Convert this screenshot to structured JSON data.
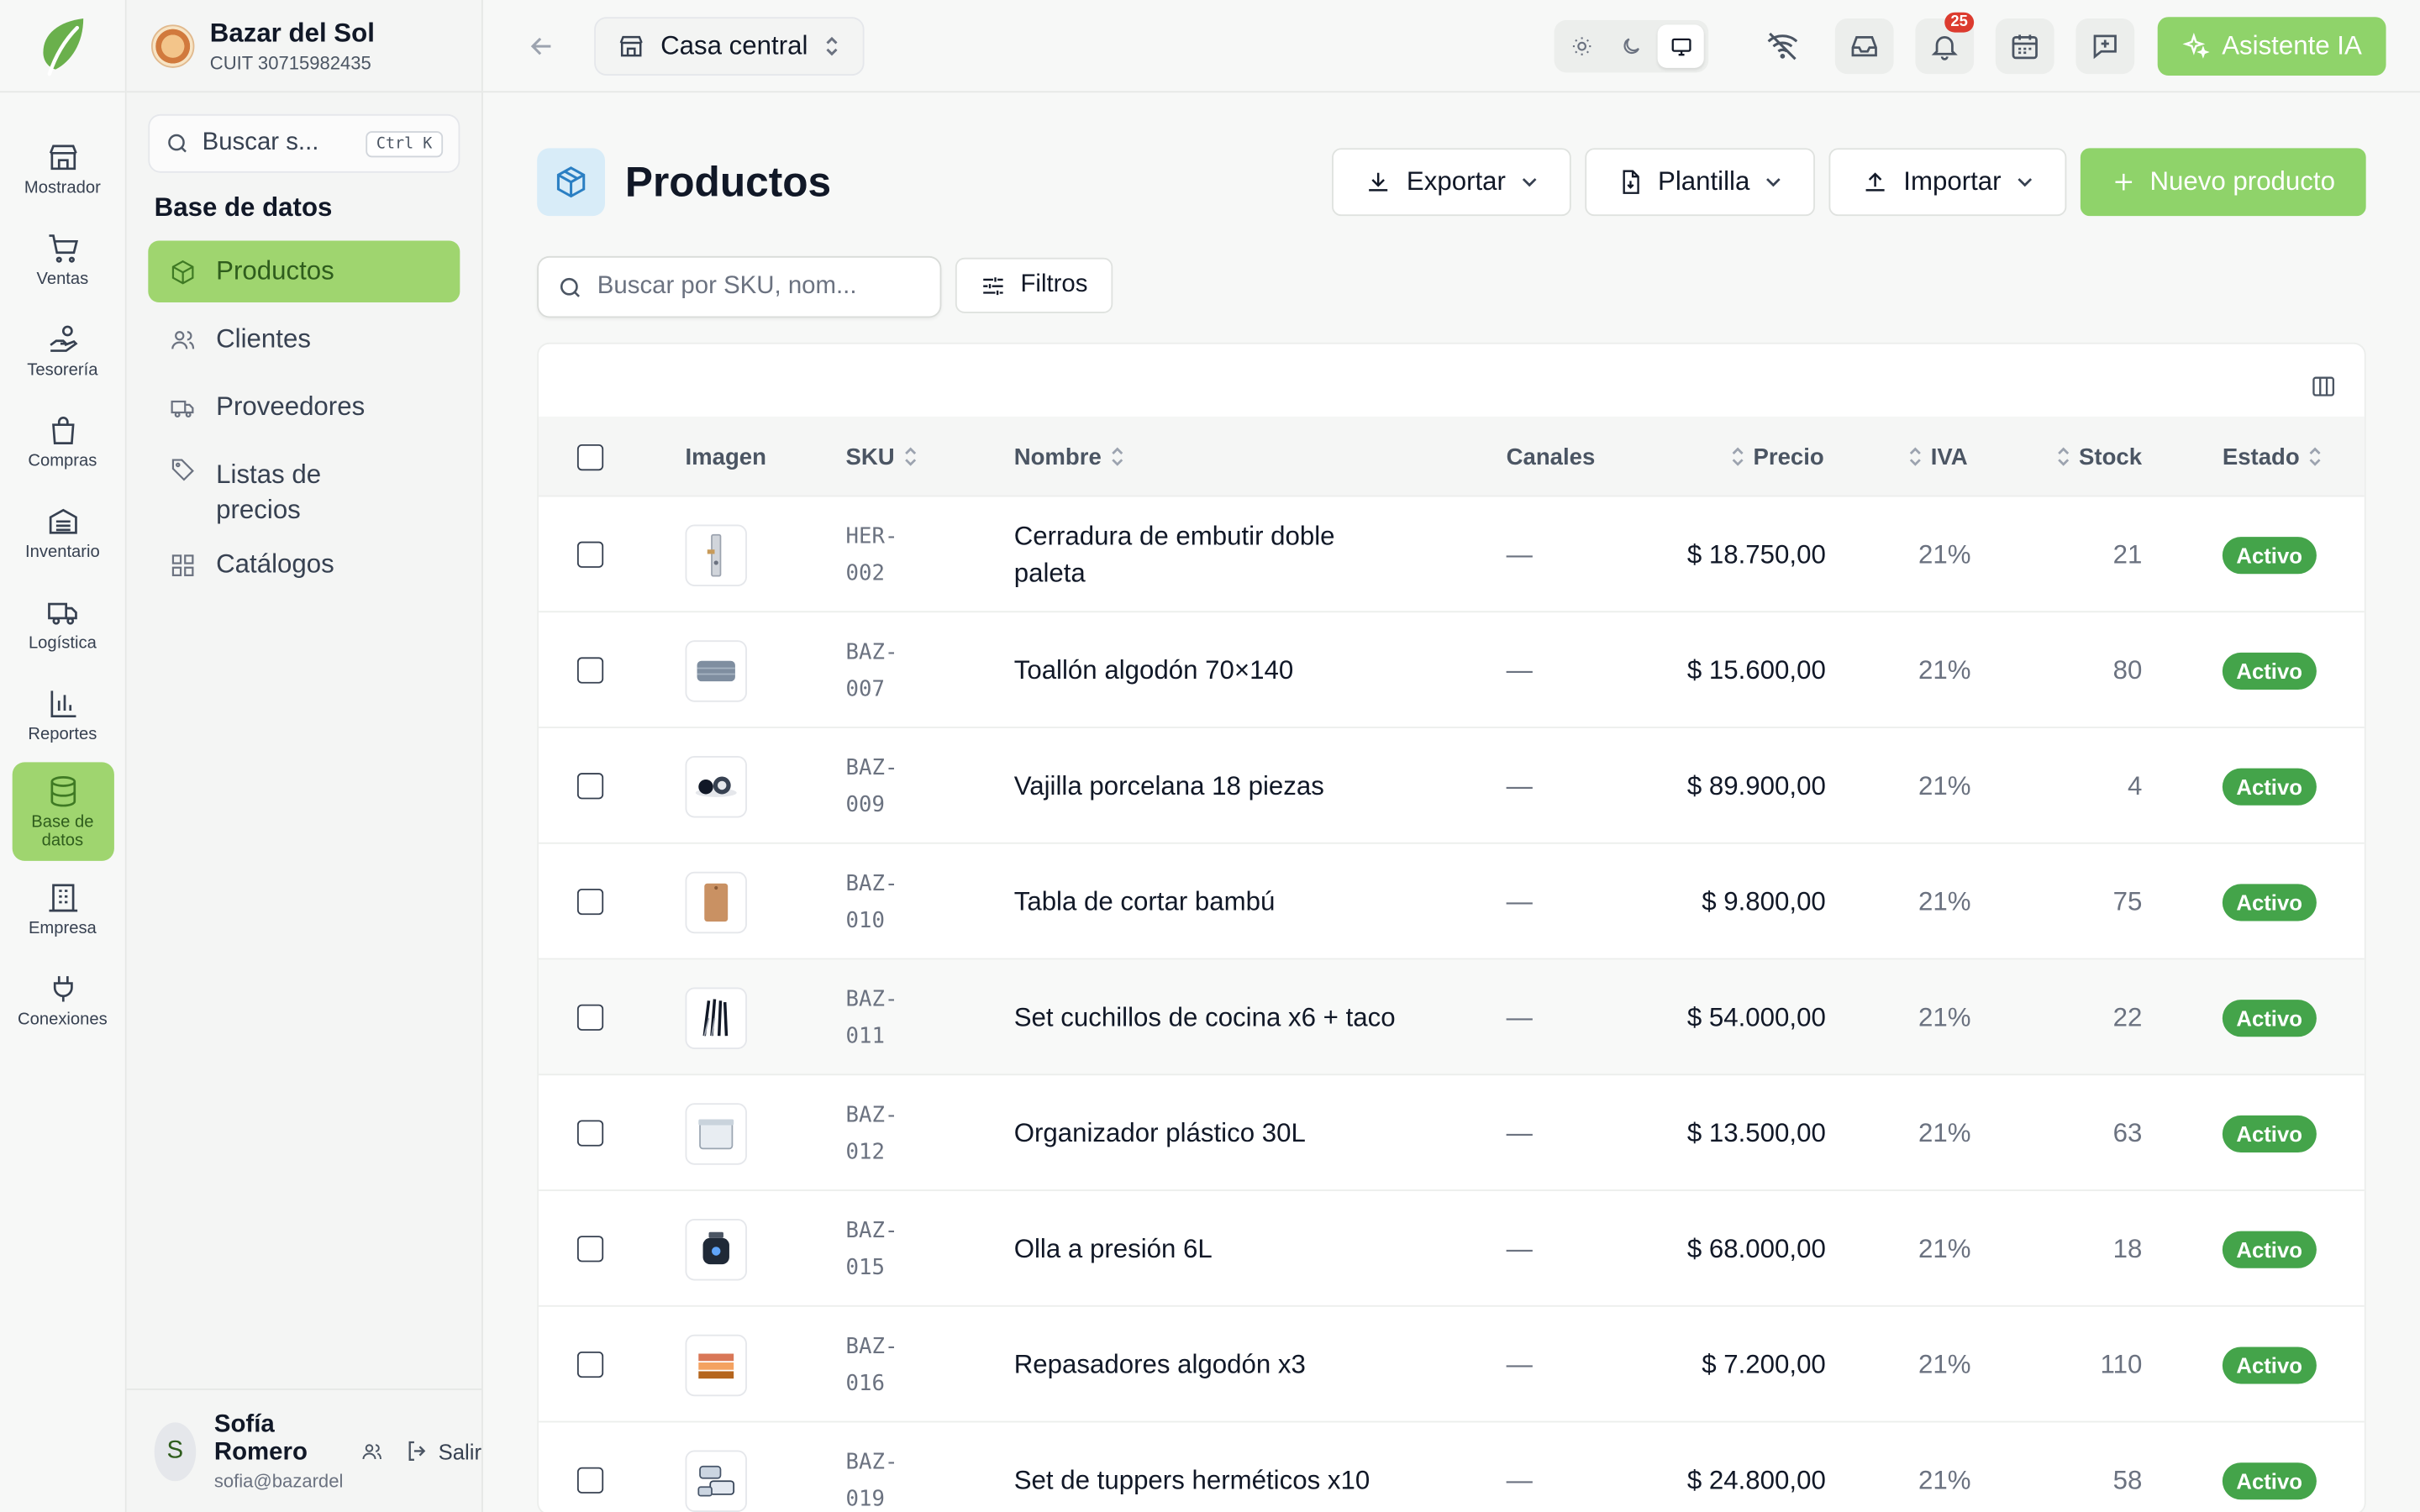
{
  "company": {
    "name": "Bazar del Sol",
    "cuit": "CUIT 30715982435"
  },
  "rail": [
    {
      "label": "Mostrador",
      "icon": "store-icon"
    },
    {
      "label": "Ventas",
      "icon": "cart-icon"
    },
    {
      "label": "Tesorería",
      "icon": "hand-coins-icon"
    },
    {
      "label": "Compras",
      "icon": "shopping-bag-icon"
    },
    {
      "label": "Inventario",
      "icon": "warehouse-icon"
    },
    {
      "label": "Logística",
      "icon": "truck-icon"
    },
    {
      "label": "Reportes",
      "icon": "bar-chart-icon"
    },
    {
      "label": "Base de datos",
      "icon": "database-icon"
    },
    {
      "label": "Empresa",
      "icon": "building-icon"
    },
    {
      "label": "Conexiones",
      "icon": "plug-icon"
    }
  ],
  "sidebar": {
    "search_placeholder": "Buscar s...",
    "shortcut": "Ctrl K",
    "section_title": "Base de datos",
    "items": [
      {
        "label": "Productos",
        "icon": "box-icon"
      },
      {
        "label": "Clientes",
        "icon": "users-icon"
      },
      {
        "label": "Proveedores",
        "icon": "truck-icon"
      },
      {
        "label": "Listas de precios",
        "icon": "tag-icon"
      },
      {
        "label": "Catálogos",
        "icon": "grid-icon"
      }
    ]
  },
  "user": {
    "name": "Sofía Romero",
    "email": "sofia@bazardelsol...",
    "initial": "S",
    "logout": "Salir"
  },
  "topbar": {
    "branch": "Casa central",
    "notifications": "25",
    "ai_button": "Asistente IA"
  },
  "page": {
    "title": "Productos",
    "export": "Exportar",
    "template": "Plantilla",
    "import": "Importar",
    "new": "Nuevo producto",
    "search_placeholder": "Buscar por SKU, nom...",
    "filters": "Filtros"
  },
  "table": {
    "headers": {
      "image": "Imagen",
      "sku": "SKU",
      "name": "Nombre",
      "channels": "Canales",
      "price": "Precio",
      "iva": "IVA",
      "stock": "Stock",
      "status": "Estado"
    },
    "rows": [
      {
        "sku1": "HER-",
        "sku2": "002",
        "name": "Cerradura de embutir doble paleta",
        "channels": "—",
        "price": "$ 18.750,00",
        "iva": "21%",
        "stock": "21",
        "status": "Activo",
        "thumb": "lock"
      },
      {
        "sku1": "BAZ-",
        "sku2": "007",
        "name": "Toallón algodón 70×140",
        "channels": "—",
        "price": "$ 15.600,00",
        "iva": "21%",
        "stock": "80",
        "status": "Activo",
        "thumb": "towel"
      },
      {
        "sku1": "BAZ-",
        "sku2": "009",
        "name": "Vajilla porcelana 18 piezas",
        "channels": "—",
        "price": "$ 89.900,00",
        "iva": "21%",
        "stock": "4",
        "status": "Activo",
        "thumb": "dishes"
      },
      {
        "sku1": "BAZ-",
        "sku2": "010",
        "name": "Tabla de cortar bambú",
        "channels": "—",
        "price": "$ 9.800,00",
        "iva": "21%",
        "stock": "75",
        "status": "Activo",
        "thumb": "board"
      },
      {
        "sku1": "BAZ-",
        "sku2": "011",
        "name": "Set cuchillos de cocina x6 + taco",
        "channels": "—",
        "price": "$ 54.000,00",
        "iva": "21%",
        "stock": "22",
        "status": "Activo",
        "thumb": "knives"
      },
      {
        "sku1": "BAZ-",
        "sku2": "012",
        "name": "Organizador plástico 30L",
        "channels": "—",
        "price": "$ 13.500,00",
        "iva": "21%",
        "stock": "63",
        "status": "Activo",
        "thumb": "box"
      },
      {
        "sku1": "BAZ-",
        "sku2": "015",
        "name": "Olla a presión 6L",
        "channels": "—",
        "price": "$ 68.000,00",
        "iva": "21%",
        "stock": "18",
        "status": "Activo",
        "thumb": "pot"
      },
      {
        "sku1": "BAZ-",
        "sku2": "016",
        "name": "Repasadores algodón x3",
        "channels": "—",
        "price": "$ 7.200,00",
        "iva": "21%",
        "stock": "110",
        "status": "Activo",
        "thumb": "cloths"
      },
      {
        "sku1": "BAZ-",
        "sku2": "019",
        "name": "Set de tuppers herméticos x10",
        "channels": "—",
        "price": "$ 24.800,00",
        "iva": "21%",
        "stock": "58",
        "status": "Activo",
        "thumb": "tuppers"
      }
    ]
  },
  "colors": {
    "accent": "#8fd36a",
    "active_nav": "#9fd56f",
    "status_green": "#44a44a",
    "badge_red": "#dc3b2f"
  }
}
